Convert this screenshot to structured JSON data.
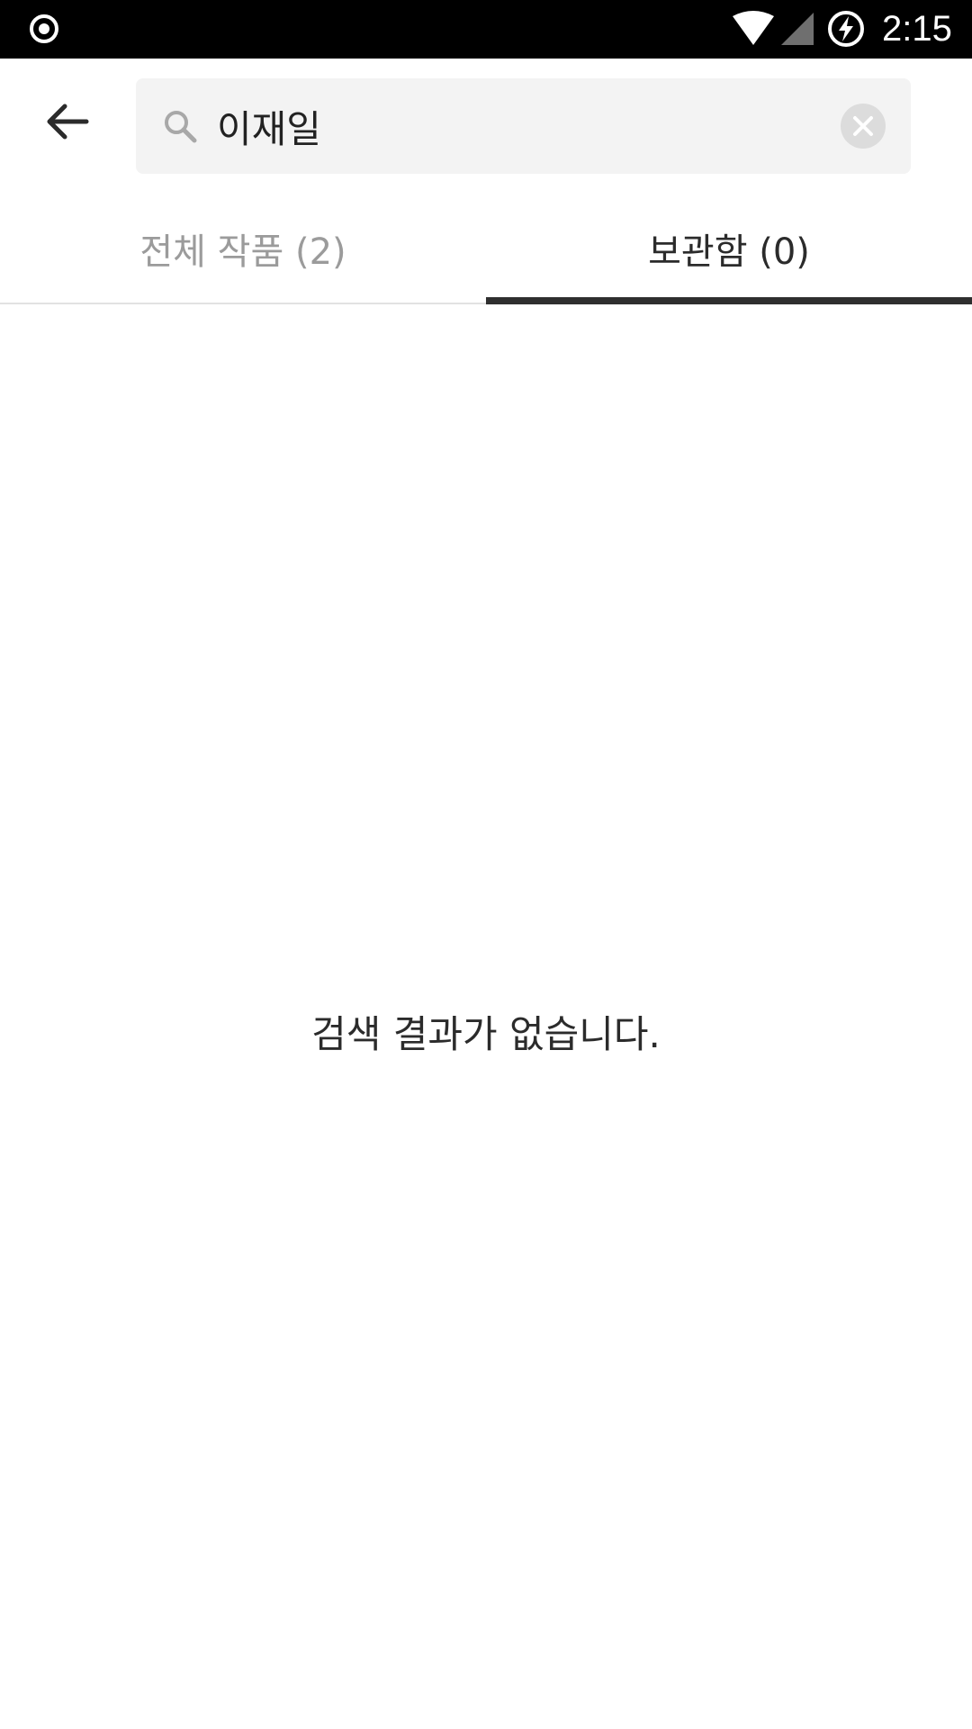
{
  "status_bar": {
    "time": "2:15",
    "icons": [
      "record-icon",
      "wifi-icon",
      "cell-signal-icon",
      "battery-charging-icon"
    ]
  },
  "header": {
    "back_icon": "arrow-left-icon",
    "search": {
      "icon": "search-icon",
      "value": "이재일",
      "clear_icon": "close-circle-icon"
    }
  },
  "tabs": [
    {
      "label": "전체 작품 (2)",
      "active": false
    },
    {
      "label": "보관함 (0)",
      "active": true
    }
  ],
  "content": {
    "empty_message": "검색 결과가 없습니다."
  },
  "colors": {
    "status_bar": "#000000",
    "search_bg": "#f3f3f3",
    "active_tab": "#2b2b2b",
    "inactive_tab": "#9b9b9b",
    "indicator": "#2f2f2f"
  }
}
